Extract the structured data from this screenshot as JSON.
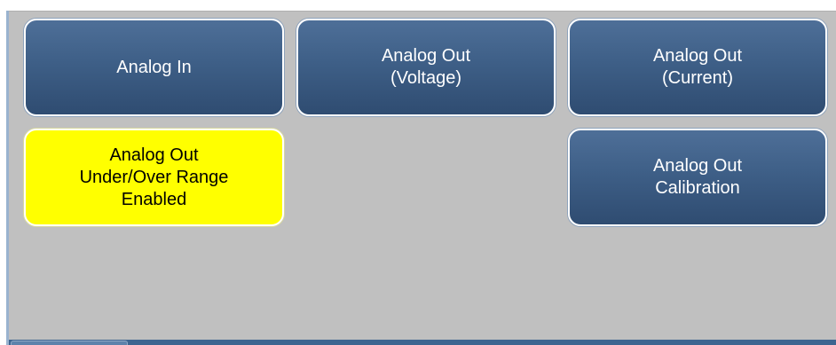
{
  "buttons": {
    "analog_in": {
      "label": "Analog In"
    },
    "analog_out_voltage": {
      "label": "Analog Out\n(Voltage)"
    },
    "analog_out_current": {
      "label": "Analog Out\n(Current)"
    },
    "under_over_range": {
      "label": "Analog Out\nUnder/Over Range\nEnabled",
      "state": "enabled"
    },
    "analog_out_calibration": {
      "label": "Analog Out\nCalibration"
    }
  },
  "colors": {
    "button_blue": "#3e5f87",
    "button_active_yellow": "#ffff00",
    "panel_background": "#c0c0c0",
    "bottom_bar": "#3d6590"
  }
}
